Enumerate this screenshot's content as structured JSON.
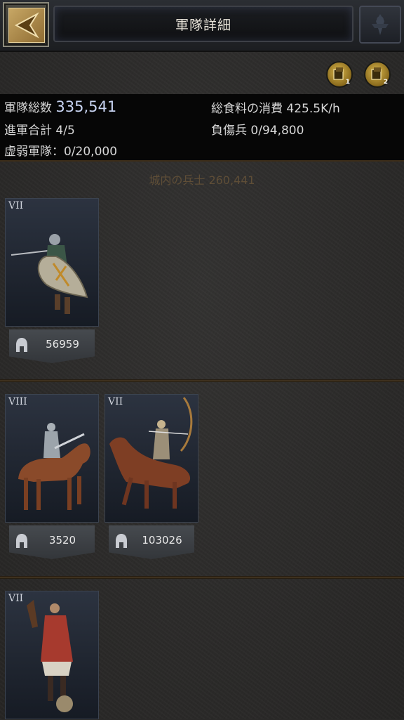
{
  "header": {
    "title": "軍隊詳細",
    "back_icon": "back-arrow-icon",
    "emblem_icon": "emblem-icon"
  },
  "pins": [
    {
      "sub": "1",
      "icon": "pin-preset-icon"
    },
    {
      "sub": "2",
      "icon": "pin-preset-icon"
    }
  ],
  "stats": {
    "total_troops_label": "軍隊総数",
    "total_troops_value": "335,541",
    "food_label": "総食料の消費",
    "food_value": "425.5K/h",
    "march_label": "進軍合計",
    "march_value": "4/5",
    "wounded_label": "負傷兵",
    "wounded_value": "0/94,800",
    "weak_label": "虚弱軍隊：",
    "weak_value": "0/20,000"
  },
  "castle_text": "城内の兵士 260,441",
  "troops": [
    {
      "tier": "VII",
      "type": "infantry",
      "count": "56959"
    },
    {
      "tier": "VIII",
      "type": "cavalry",
      "count": "3520"
    },
    {
      "tier": "VII",
      "type": "horse-archer",
      "count": "103026"
    },
    {
      "tier": "VII",
      "type": "siege",
      "count": ""
    }
  ],
  "colors": {
    "accent_value": "#c8d4f2",
    "castle_text": "#5f4e37",
    "card_bg": "#2c3340"
  }
}
